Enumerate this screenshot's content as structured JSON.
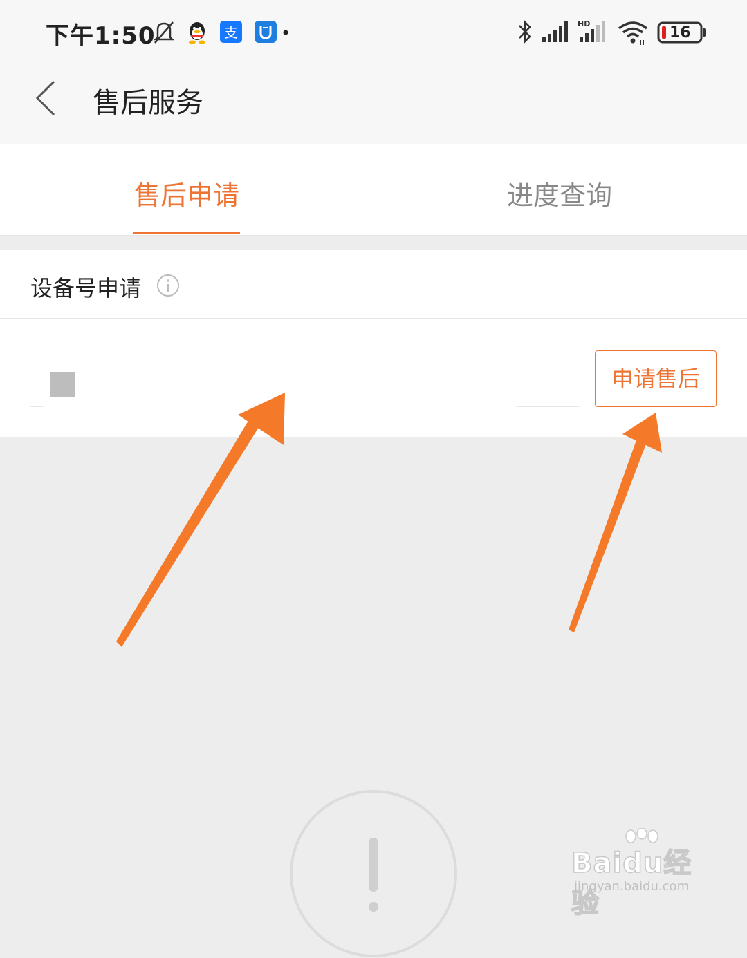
{
  "status_bar": {
    "time": "下午1:50",
    "battery": "16",
    "icons": [
      "bell-off-icon",
      "qq-icon",
      "alipay-icon",
      "shield-app-icon",
      "dot-icon",
      "bluetooth-icon",
      "signal-icon",
      "hd-signal-icon",
      "wifi-icon",
      "battery-icon"
    ]
  },
  "nav": {
    "back_icon": "chevron-left-icon",
    "title": "售后服务"
  },
  "tabs": [
    {
      "label": "售后申请",
      "active": true
    },
    {
      "label": "进度查询",
      "active": false
    }
  ],
  "section": {
    "title": "设备号申请",
    "info_icon": "info-icon",
    "apply_button": "申请售后"
  },
  "empty_state": {
    "icon": "exclamation-circle-icon"
  },
  "watermark": {
    "brand": "Baidu经验",
    "url": "jingyan.baidu.com"
  },
  "colors": {
    "accent": "#ee7434",
    "arrow": "#f47a2a",
    "background": "#ededed",
    "surface": "#ffffff"
  }
}
